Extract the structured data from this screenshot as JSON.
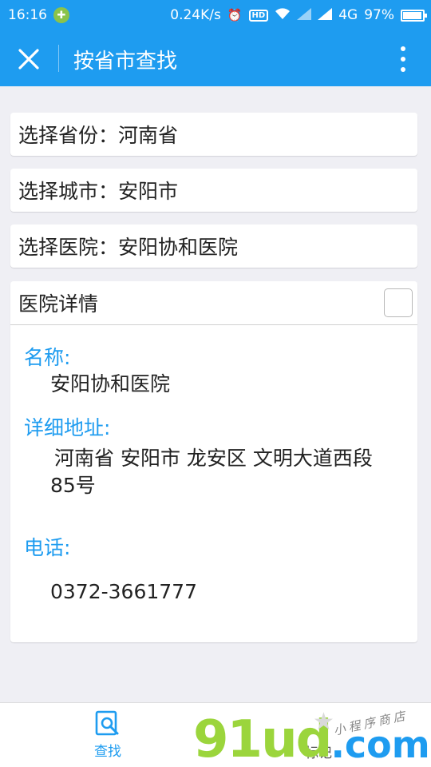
{
  "status_bar": {
    "time": "16:16",
    "net_speed": "0.24K/s",
    "network_type": "4G",
    "battery": "97%",
    "battery_level": 0.97
  },
  "app_bar": {
    "title": "按省市查找"
  },
  "selectors": {
    "province": {
      "label": "选择省份：",
      "value": "河南省"
    },
    "city": {
      "label": "选择城市：",
      "value": "安阳市"
    },
    "hospital": {
      "label": "选择医院：",
      "value": "安阳协和医院"
    }
  },
  "details": {
    "header": "医院详情",
    "name_label": "名称:",
    "name_value": "安阳协和医院",
    "address_label": "详细地址:",
    "address_line1": "河南省 安阳市 龙安区 文明大道西段",
    "address_line2": "85号",
    "phone_label": "电话:",
    "phone_value": "0372-3661777"
  },
  "tabs": [
    {
      "label": "查找",
      "icon": "search-doc-icon",
      "active": true
    },
    {
      "label": "标记",
      "icon": "",
      "active": false
    }
  ],
  "watermark": {
    "main": "91ud",
    "dot": ".com",
    "sub": "小程序商店"
  },
  "colors": {
    "primary": "#1e9cf0",
    "background": "#efeff4",
    "watermark_green": "#9bd53c"
  }
}
